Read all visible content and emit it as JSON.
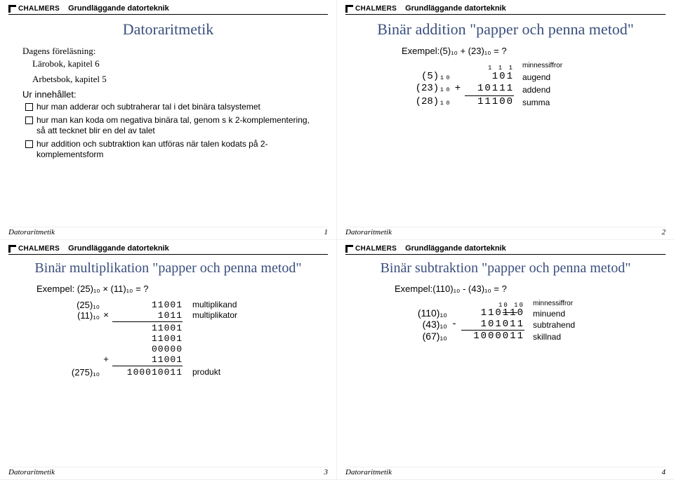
{
  "brand": "CHALMERS",
  "course": "Grundläggande datorteknik",
  "footer_label": "Datoraritmetik",
  "slide1": {
    "title": "Datoraritmetik",
    "lecture_h": "Dagens föreläsning:",
    "lecture_a": "Lärobok, kapitel 6",
    "lecture_b": "Arbetsbok, kapitel 5",
    "contents_h": "Ur innehållet:",
    "b1": "hur man adderar och subtraherar tal i det binära talsystemet",
    "b2": "hur man kan koda om negativa binära tal, genom s k 2-komplementering, så att tecknet blir en del av talet",
    "b3": "hur addition och subtraktion kan utföras när talen kodats på 2-komplementsform",
    "page": "1"
  },
  "slide2": {
    "title": "Binär addition \"papper och penna metod\"",
    "example": "Exempel:(5)₁₀ + (23)₁₀ = ?",
    "carry": "1 1 1",
    "carry_lbl": "minnessiffror",
    "a_dec": "(5)₁₀",
    "a_bin": "101",
    "a_lbl": "augend",
    "b_dec": "(23)₁₀",
    "b_op": "+",
    "b_bin": "10111",
    "b_lbl": "addend",
    "s_dec": "(28)₁₀",
    "s_bin": "11100",
    "s_lbl": "summa",
    "page": "2"
  },
  "slide3": {
    "title": "Binär multiplikation \"papper och penna metod\"",
    "example": "Exempel: (25)₁₀ × (11)₁₀ = ?",
    "m1_dec": "(25)₁₀",
    "m1_bin": "11001",
    "m1_lbl": "multiplikand",
    "m2_dec": "(11)₁₀",
    "m2_op": "×",
    "m2_bin": "1011",
    "m2_lbl": "multiplikator",
    "p1": "11001",
    "p2": "11001 ",
    "p3": "00000  ",
    "p4_op": "+",
    "p4": "11001   ",
    "r_dec": "(275)₁₀",
    "r_bin": "100010011",
    "r_lbl": "produkt",
    "page": "3"
  },
  "slide4": {
    "title": "Binär subtraktion \"papper och penna metod\"",
    "example": "Exempel:(110)₁₀ - (43)₁₀ = ?",
    "borrow": "10 10",
    "borrow_lbl": "minnessiffror",
    "a_dec": "(110)₁₀",
    "a_bin_pre": "110",
    "a_bin_strike": "11",
    "a_bin_post": "0",
    "a_lbl": "minuend",
    "b_dec": "(43)₁₀",
    "b_op": "-",
    "b_bin": "101011",
    "b_lbl": "subtrahend",
    "d_dec": "(67)₁₀",
    "d_bin": "1000011",
    "d_lbl": "skillnad",
    "page": "4"
  }
}
